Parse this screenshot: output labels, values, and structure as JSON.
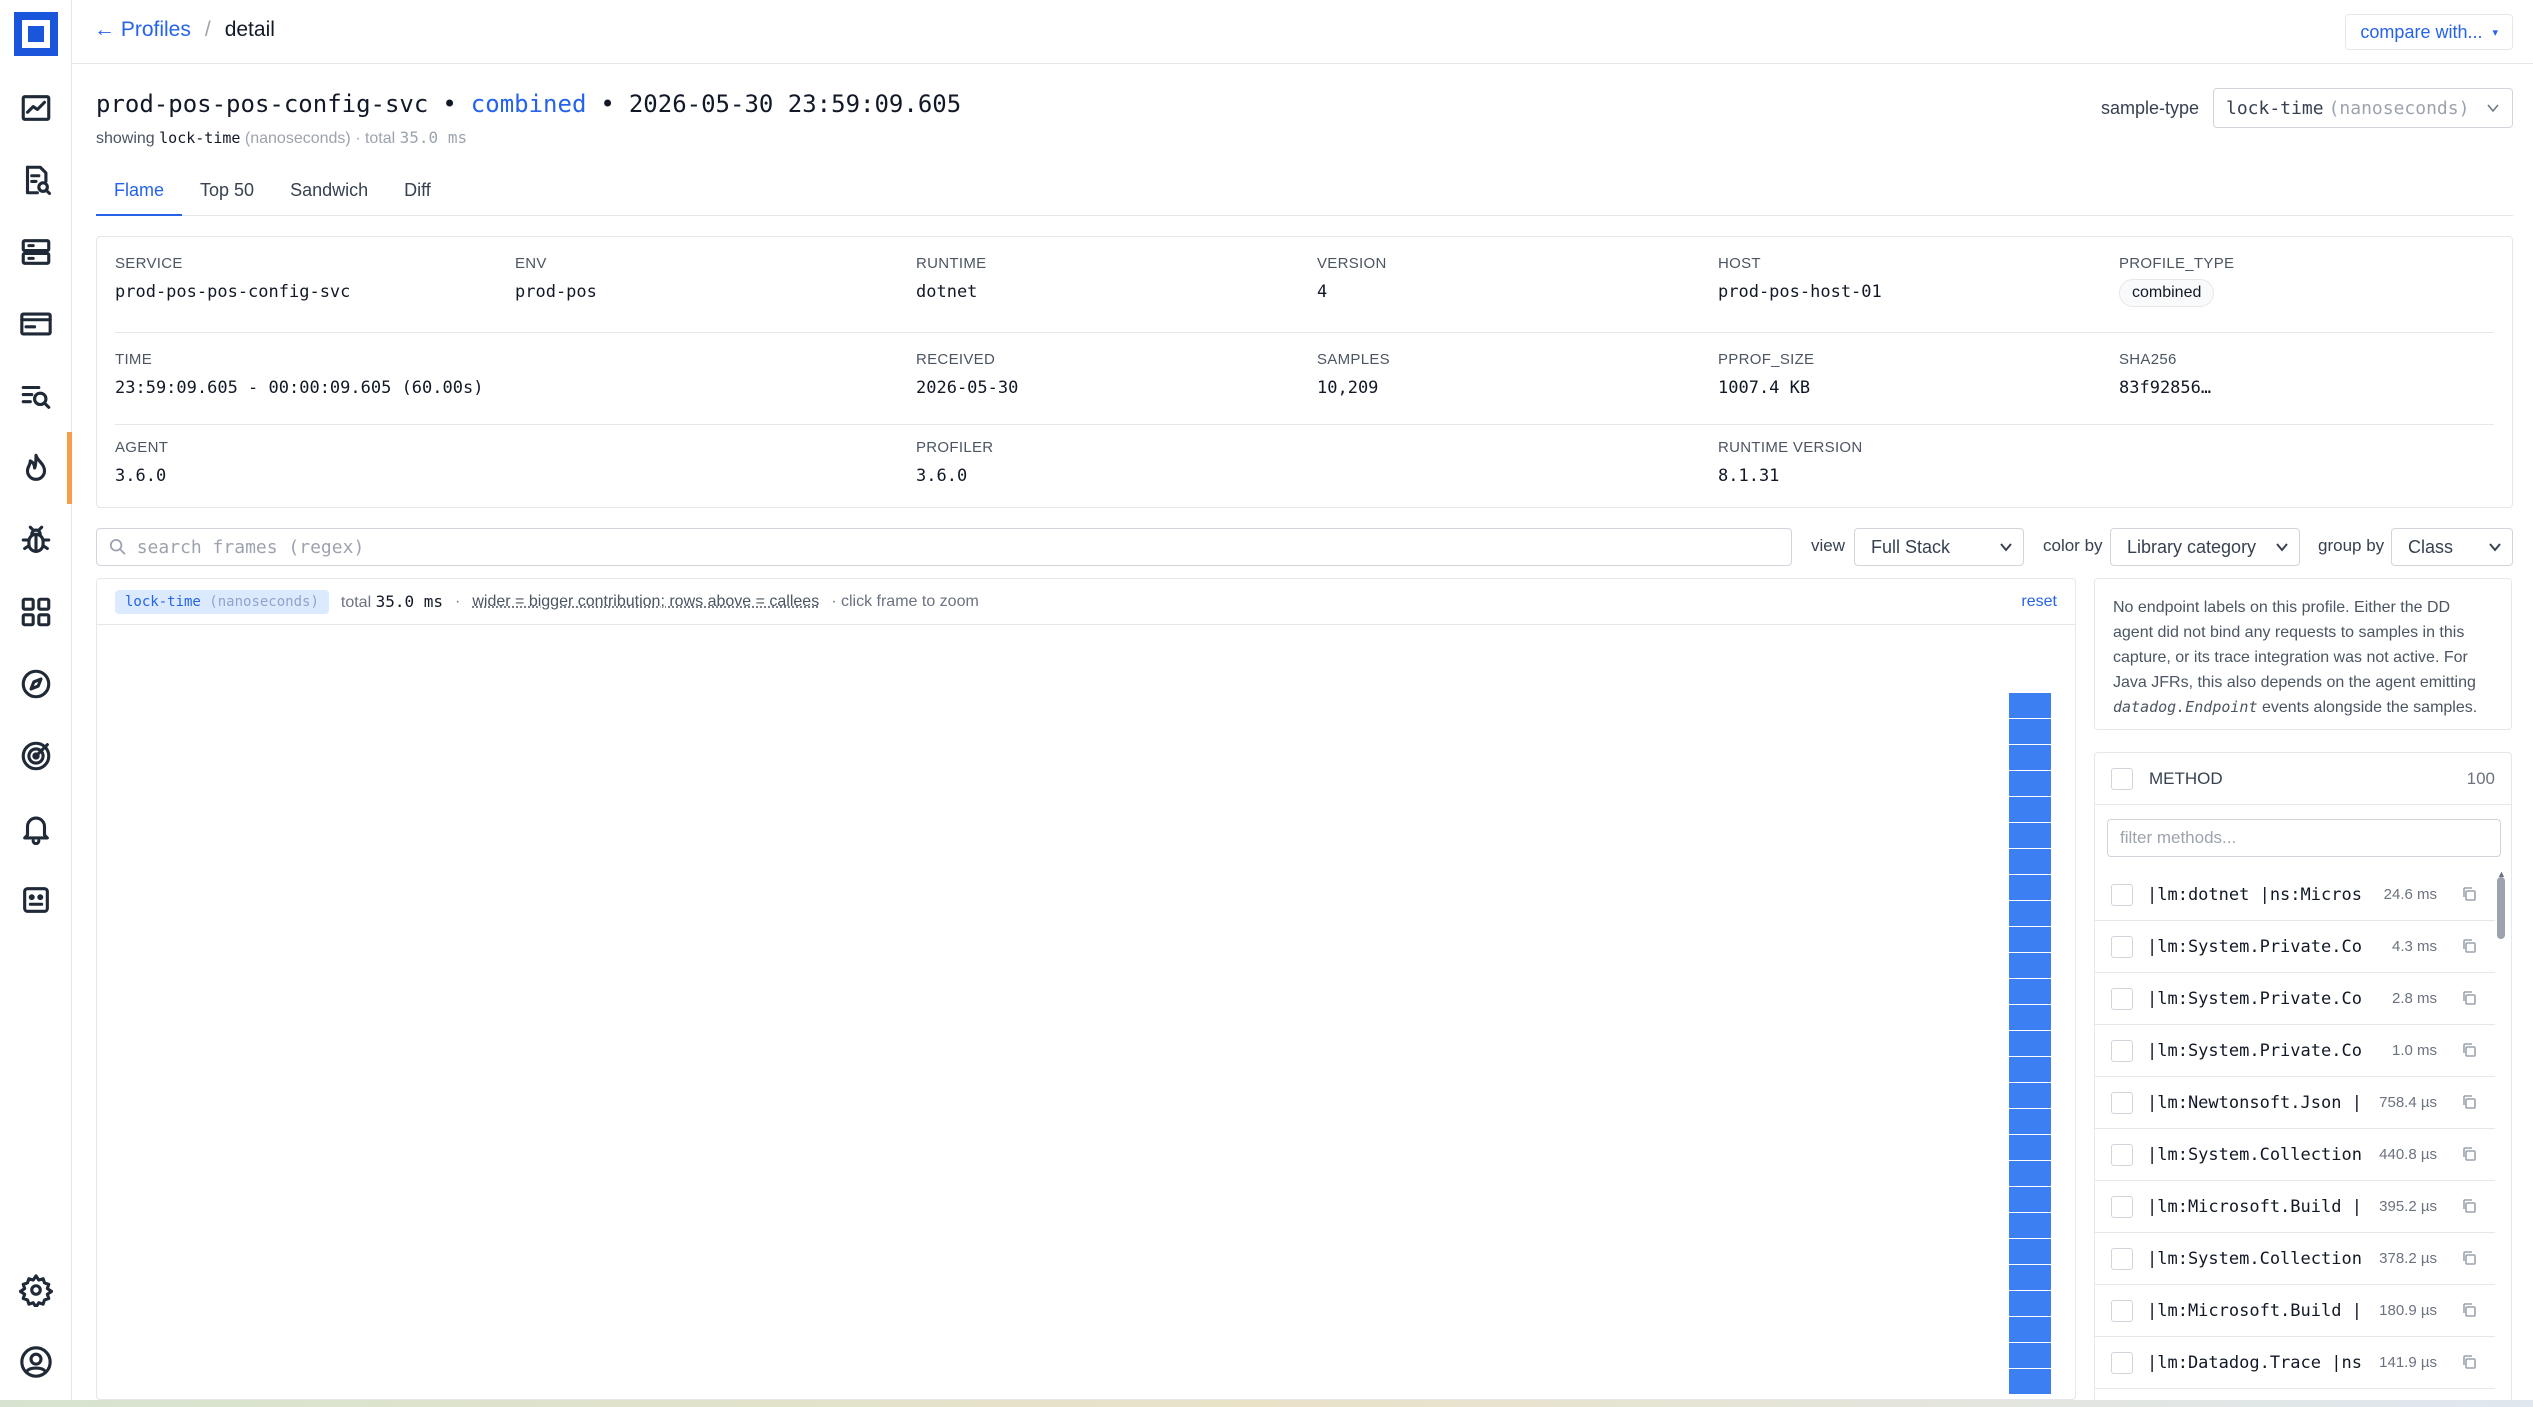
{
  "breadcrumb": {
    "back_label": "← Profiles",
    "separator": "/",
    "current": "detail"
  },
  "header": {
    "compare_label": "compare with...",
    "compare_caret": "▾"
  },
  "profile": {
    "service": "prod-pos-pos-config-svc",
    "kind": "combined",
    "timestamp": "2026-05-30 23:59:09.605",
    "dot": "•",
    "showing_prefix": "showing",
    "showing_type": "lock-time",
    "showing_unit": "(nanoseconds)",
    "total_prefix": "· total",
    "total_value": "35.0 ms"
  },
  "sample_type": {
    "label": "sample-type",
    "value": "lock-time",
    "unit": "(nanoseconds)"
  },
  "tabs": [
    {
      "label": "Flame",
      "active": true
    },
    {
      "label": "Top 50",
      "active": false
    },
    {
      "label": "Sandwich",
      "active": false
    },
    {
      "label": "Diff",
      "active": false
    }
  ],
  "meta": {
    "service": {
      "key": "SERVICE",
      "value": "prod-pos-pos-config-svc"
    },
    "env": {
      "key": "ENV",
      "value": "prod-pos"
    },
    "runtime": {
      "key": "RUNTIME",
      "value": "dotnet"
    },
    "version": {
      "key": "VERSION",
      "value": "4"
    },
    "host": {
      "key": "HOST",
      "value": "prod-pos-host-01"
    },
    "profile_type": {
      "key": "PROFILE_TYPE",
      "value": "combined"
    },
    "time": {
      "key": "TIME",
      "value": "23:59:09.605 - 00:00:09.605 (60.00s)"
    },
    "received": {
      "key": "RECEIVED",
      "value": "2026-05-30"
    },
    "samples": {
      "key": "SAMPLES",
      "value": "10,209"
    },
    "pprof_size": {
      "key": "PPROF_SIZE",
      "value": "1007.4 KB"
    },
    "sha256": {
      "key": "SHA256",
      "value": "83f92856…"
    },
    "agent": {
      "key": "AGENT",
      "value": "3.6.0"
    },
    "profiler": {
      "key": "PROFILER",
      "value": "3.6.0"
    },
    "runtime_version": {
      "key": "RUNTIME VERSION",
      "value": "8.1.31"
    }
  },
  "search": {
    "placeholder": "search frames (regex)"
  },
  "controls": {
    "view_label": "view",
    "view_value": "Full Stack",
    "color_label": "color by",
    "color_value": "Library category",
    "group_label": "group by",
    "group_value": "Class"
  },
  "flame": {
    "pill_type": "lock-time",
    "pill_unit": "(nanoseconds)",
    "total_label": "total",
    "total_value": "35.0 ms",
    "bullet": "·",
    "hint": "wider = bigger contribution; rows above = callees",
    "zoom_hint": "· click frame to zoom",
    "reset_label": "reset",
    "frame_color": "#3b7ff2",
    "frame_count": 27
  },
  "note": {
    "text_before": "No endpoint labels on this profile. Either the DD agent did not bind any requests to samples in this capture, or its trace integration was not active. For Java JFRs, this also depends on the agent emitting",
    "code": "datadog.Endpoint",
    "text_after": "events alongside the samples."
  },
  "methods": {
    "header": "METHOD",
    "count": "100",
    "filter_placeholder": "filter methods...",
    "items": [
      {
        "name": "|lm:dotnet |ns:Microsoft.Extensions",
        "value": "24.6 ms"
      },
      {
        "name": "|lm:System.Private.CoreLib",
        "value": "4.3 ms"
      },
      {
        "name": "|lm:System.Private.CoreLib",
        "value": "2.8 ms"
      },
      {
        "name": "|lm:System.Private.CoreLib",
        "value": "1.0 ms"
      },
      {
        "name": "|lm:Newtonsoft.Json |ns:Newtonsoft",
        "value": "758.4 µs"
      },
      {
        "name": "|lm:System.Collections.Concurrent",
        "value": "440.8 µs"
      },
      {
        "name": "|lm:Microsoft.Build |ns:Microsoft",
        "value": "395.2 µs"
      },
      {
        "name": "|lm:System.Collections.Generic",
        "value": "378.2 µs"
      },
      {
        "name": "|lm:Microsoft.Build |ns:Microsoft",
        "value": "180.9 µs"
      },
      {
        "name": "|lm:Datadog.Trace |ns:Datadog",
        "value": "141.9 µs"
      }
    ]
  },
  "nav": {
    "logo": "app-logo",
    "icons": [
      "dashboard-chart-icon",
      "log-search-icon",
      "servers-icon",
      "browser-window-icon",
      "trace-search-icon",
      "flame-profiler-icon",
      "bug-icon",
      "apps-grid-icon",
      "compass-icon",
      "target-icon",
      "bell-icon",
      "robot-icon",
      "settings-gear-icon",
      "user-account-icon"
    ],
    "active_accent": "#f59e4b"
  },
  "colors": {
    "accent": "#2563eb",
    "frame": "#3b7ff2"
  }
}
